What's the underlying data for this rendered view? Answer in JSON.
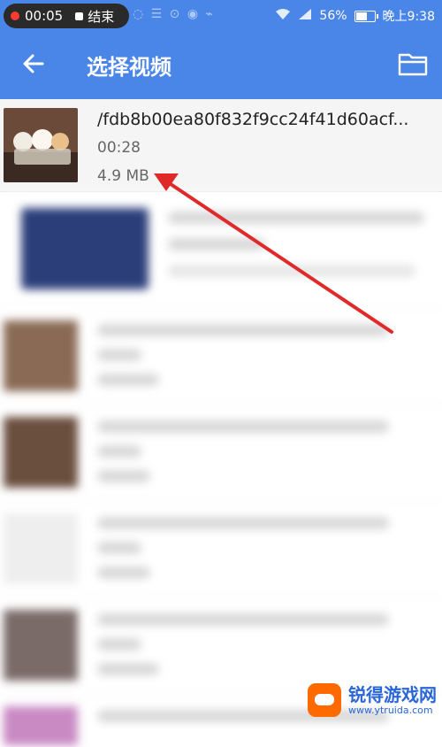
{
  "status_bar": {
    "recording_time": "00:05",
    "end_label": "结束",
    "battery_percent": "56%",
    "battery_level": 0.56,
    "clock": "晚上9:38"
  },
  "app_bar": {
    "title": "选择视频",
    "icons": {
      "back": "arrow-left-icon",
      "folder": "folder-icon"
    }
  },
  "selected_video": {
    "name": "/fdb8b00ea80f832f9cc24f41d60acf...",
    "duration": "00:28",
    "size": "4.9 MB"
  },
  "watermark": {
    "title": "锐得游戏网",
    "url": "www.ytruida.com"
  },
  "colors": {
    "primary": "#4a86e8",
    "annotation_arrow": "#e02a2a",
    "watermark_blue": "#2a66d8"
  }
}
